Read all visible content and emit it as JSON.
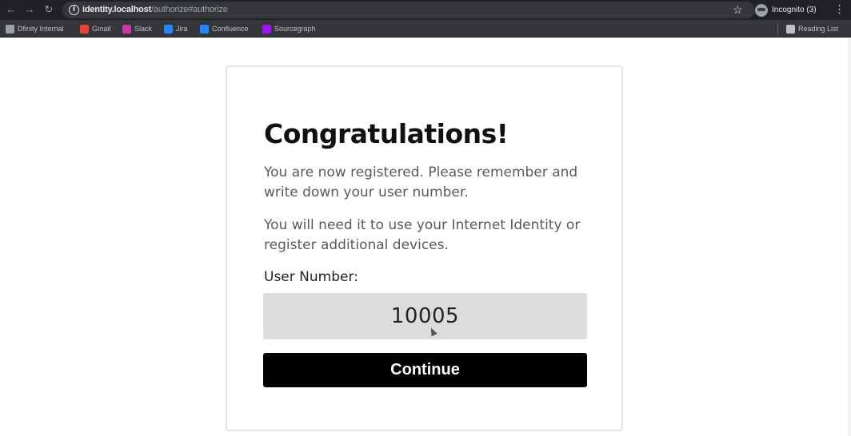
{
  "browser": {
    "url_host": "identity.localhost",
    "url_path": "/authorize#authorize",
    "profile_label": "Incognito (3)",
    "bookmarks": [
      {
        "label": "Dfinity Internal",
        "color": "#9aa0a6",
        "icon": "folder-icon"
      },
      {
        "label": "Gmail",
        "color": "#ea4335",
        "icon": "gmail-icon"
      },
      {
        "label": "Slack",
        "color": "#c837ab",
        "icon": "slack-icon"
      },
      {
        "label": "Jira",
        "color": "#2684ff",
        "icon": "jira-icon"
      },
      {
        "label": "Confluence",
        "color": "#2684ff",
        "icon": "confluence-icon"
      },
      {
        "label": "Sourcegraph",
        "color": "#a112ff",
        "icon": "sourcegraph-icon"
      }
    ],
    "reading_list_label": "Reading List"
  },
  "card": {
    "title": "Congratulations!",
    "paragraph1": "You are now registered. Please remember and write down your user number.",
    "paragraph2": "You will need it to use your Internet Identity or register additional devices.",
    "user_number_label": "User Number:",
    "user_number": "10005",
    "continue_label": "Continue"
  }
}
